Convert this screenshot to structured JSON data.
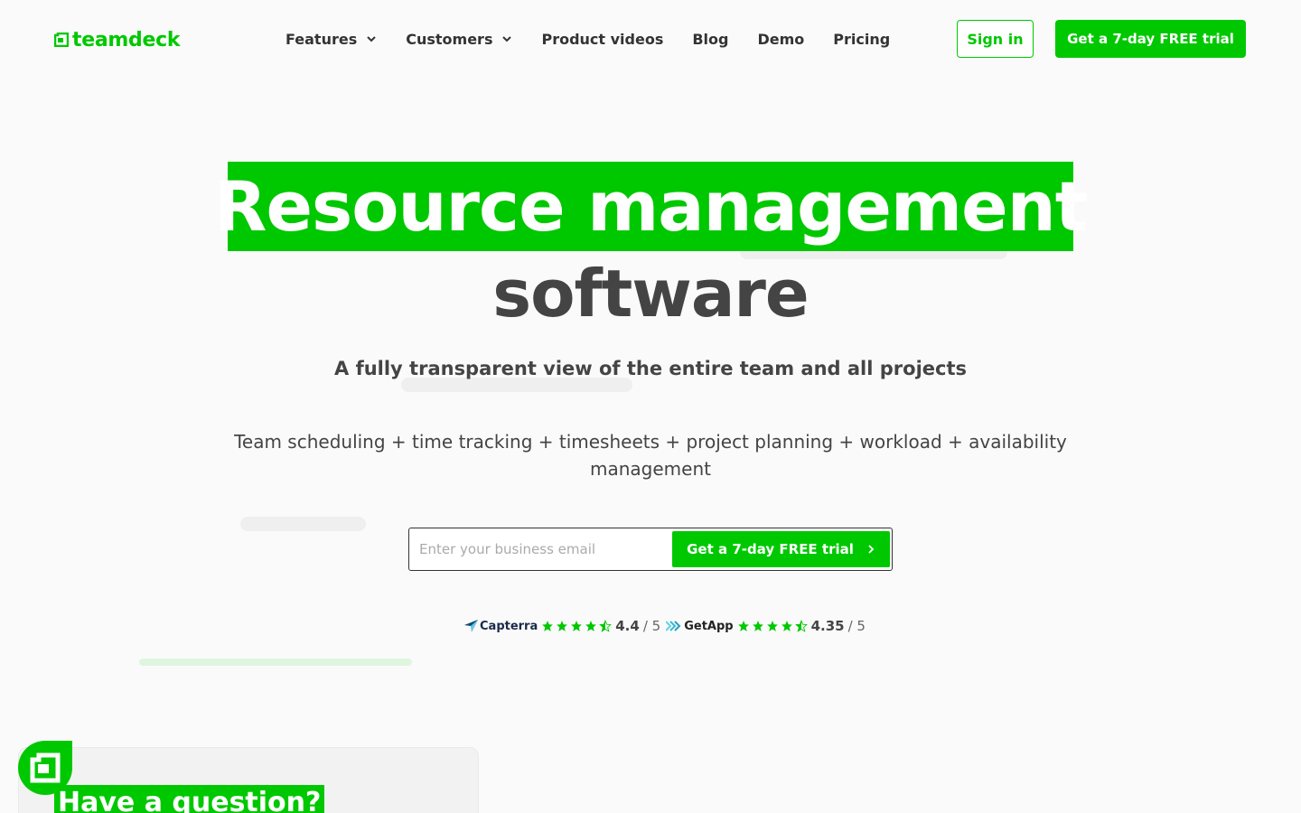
{
  "header": {
    "logo_text": "teamdeck",
    "nav": [
      {
        "label": "Features",
        "has_dropdown": true
      },
      {
        "label": "Customers",
        "has_dropdown": true
      },
      {
        "label": "Product videos",
        "has_dropdown": false
      },
      {
        "label": "Blog",
        "has_dropdown": false
      },
      {
        "label": "Demo",
        "has_dropdown": false
      },
      {
        "label": "Pricing",
        "has_dropdown": false
      }
    ],
    "signin_label": "Sign in",
    "trial_label": "Get a 7-day FREE trial"
  },
  "hero": {
    "title_highlight": "Resource management",
    "title_rest": "software",
    "subtitle": "A fully transparent view of the entire team and all projects",
    "description": "Team scheduling + time tracking + timesheets + project planning + workload + availability management"
  },
  "signup": {
    "email_placeholder": "Enter your business email",
    "button_label": "Get a 7-day FREE trial"
  },
  "ratings": [
    {
      "brand": "Capterra",
      "icon": "capterra-icon",
      "score": "4.4",
      "out_of": "/ 5",
      "stars": 4.5
    },
    {
      "brand": "GetApp",
      "icon": "getapp-icon",
      "score": "4.35",
      "out_of": "/ 5",
      "stars": 4.5
    }
  ],
  "chat_widget": {
    "title": "Have a question?"
  },
  "colors": {
    "brand_green": "#00c800",
    "text_dark": "#444444",
    "background": "#fafafa"
  }
}
